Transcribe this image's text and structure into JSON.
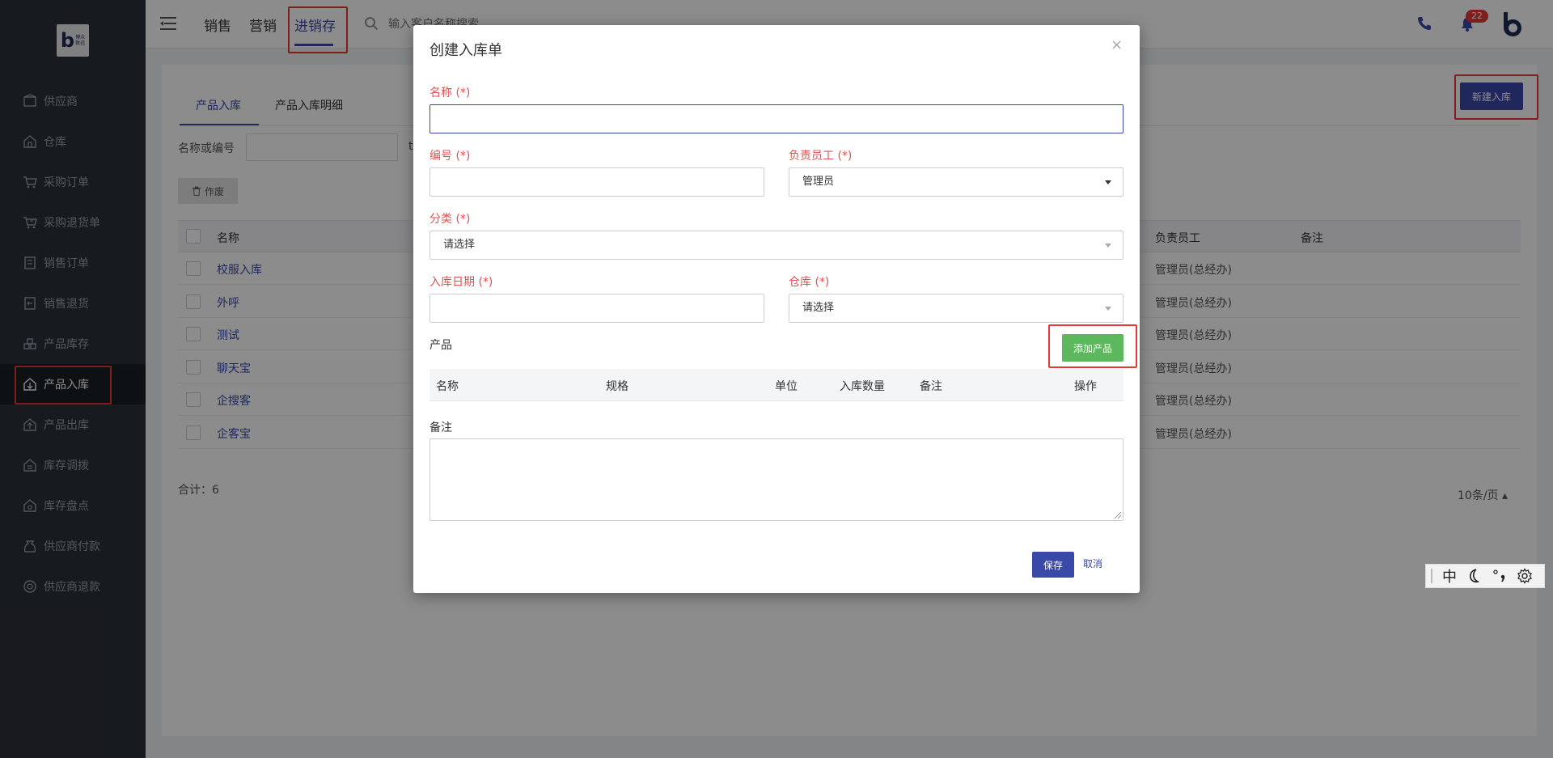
{
  "brand": {
    "logo_text": "博众\n致远",
    "colors": {
      "primary": "#3a48a8",
      "sidebar_bg": "#2b3038",
      "success": "#5cb85c",
      "highlight": "#e53935",
      "required_label": "#e05252"
    }
  },
  "sidebar": {
    "items": [
      {
        "label": "供应商",
        "icon": "supplier-icon"
      },
      {
        "label": "仓库",
        "icon": "warehouse-icon"
      },
      {
        "label": "采购订单",
        "icon": "cart-icon"
      },
      {
        "label": "采购退货单",
        "icon": "cart-return-icon"
      },
      {
        "label": "销售订单",
        "icon": "order-icon"
      },
      {
        "label": "销售退货",
        "icon": "return-icon"
      },
      {
        "label": "产品库存",
        "icon": "stock-icon"
      },
      {
        "label": "产品入库",
        "icon": "inbound-icon",
        "active": true
      },
      {
        "label": "产品出库",
        "icon": "outbound-icon"
      },
      {
        "label": "库存调拨",
        "icon": "transfer-icon"
      },
      {
        "label": "库存盘点",
        "icon": "inventory-icon"
      },
      {
        "label": "供应商付款",
        "icon": "payment-icon"
      },
      {
        "label": "供应商退款",
        "icon": "refund-icon"
      }
    ]
  },
  "topbar": {
    "tabs": [
      {
        "label": "销售"
      },
      {
        "label": "营销"
      },
      {
        "label": "进销存",
        "active": true
      }
    ],
    "search_placeholder": "输入客户名称搜索",
    "notification_count": "22"
  },
  "main": {
    "tabs": [
      {
        "label": "产品入库",
        "active": true
      },
      {
        "label": "产品入库明细"
      }
    ],
    "new_button": "新建入库",
    "filter_label": "名称或编号",
    "filter_extra": "t",
    "void_button": "作废",
    "table": {
      "headers": {
        "name": "名称",
        "employee": "负责员工",
        "remark": "备注"
      },
      "rows": [
        {
          "name": "校服入库",
          "employee": "管理员(总经办)"
        },
        {
          "name": "外呼",
          "employee": "管理员(总经办)"
        },
        {
          "name": "测试",
          "employee": "管理员(总经办)"
        },
        {
          "name": "聊天宝",
          "employee": "管理员(总经办)"
        },
        {
          "name": "企搜客",
          "employee": "管理员(总经办)"
        },
        {
          "name": "企客宝",
          "employee": "管理员(总经办)"
        }
      ]
    },
    "total": "合计：6",
    "page_size": "10条/页"
  },
  "modal": {
    "title": "创建入库单",
    "close": "×",
    "fields": {
      "name_label": "名称 (*)",
      "name_value": "",
      "code_label": "编号 (*)",
      "code_value": "",
      "employee_label": "负责员工 (*)",
      "employee_value": "管理员",
      "category_label": "分类 (*)",
      "category_value": "请选择",
      "date_label": "入库日期 (*)",
      "date_value": "",
      "warehouse_label": "仓库 (*)",
      "warehouse_value": "请选择"
    },
    "product_label": "产品",
    "add_product_button": "添加产品",
    "product_table_headers": {
      "name": "名称",
      "spec": "规格",
      "unit": "单位",
      "qty": "入库数量",
      "remark": "备注",
      "action": "操作"
    },
    "remark_label": "备注",
    "remark_value": "",
    "save_button": "保存",
    "cancel_button": "取消"
  },
  "ime": {
    "mode": "中"
  }
}
